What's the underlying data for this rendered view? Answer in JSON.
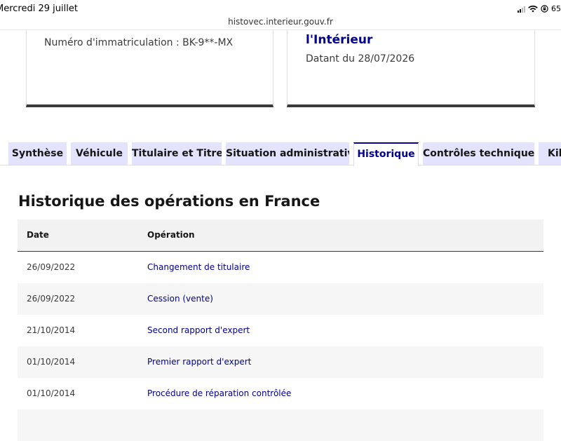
{
  "status_bar": {
    "date": "Mercredi 29 juillet",
    "battery": "65"
  },
  "browser": {
    "address": "histovec.interieur.gouv.fr"
  },
  "card_left": {
    "plate": "Numéro d'immatriculation : BK-9**-MX"
  },
  "card_right": {
    "ministry": "l'Intérieur",
    "dated": "Datant du 28/07/2026"
  },
  "tabs": [
    {
      "label": "Synthèse"
    },
    {
      "label": "Véhicule"
    },
    {
      "label": "Titulaire et Titre"
    },
    {
      "label": "Situation administrative"
    },
    {
      "label": "Historique",
      "active": true
    },
    {
      "label": "Contrôles techniques"
    },
    {
      "label": "Kilo"
    }
  ],
  "history": {
    "title": "Historique des opérations en France",
    "columns": [
      "Date",
      "Opération"
    ],
    "rows": [
      {
        "date": "26/09/2022",
        "operation": "Changement de titulaire"
      },
      {
        "date": "26/09/2022",
        "operation": "Cession (vente)"
      },
      {
        "date": "21/10/2014",
        "operation": "Second rapport d'expert"
      },
      {
        "date": "01/10/2014",
        "operation": "Premier rapport d'expert"
      },
      {
        "date": "01/10/2014",
        "operation": "Procédure de réparation contrôlée"
      }
    ]
  },
  "colors": {
    "accent": "#000091",
    "tab_bg": "#e3e3fd",
    "row_alt": "#f6f6f6"
  }
}
